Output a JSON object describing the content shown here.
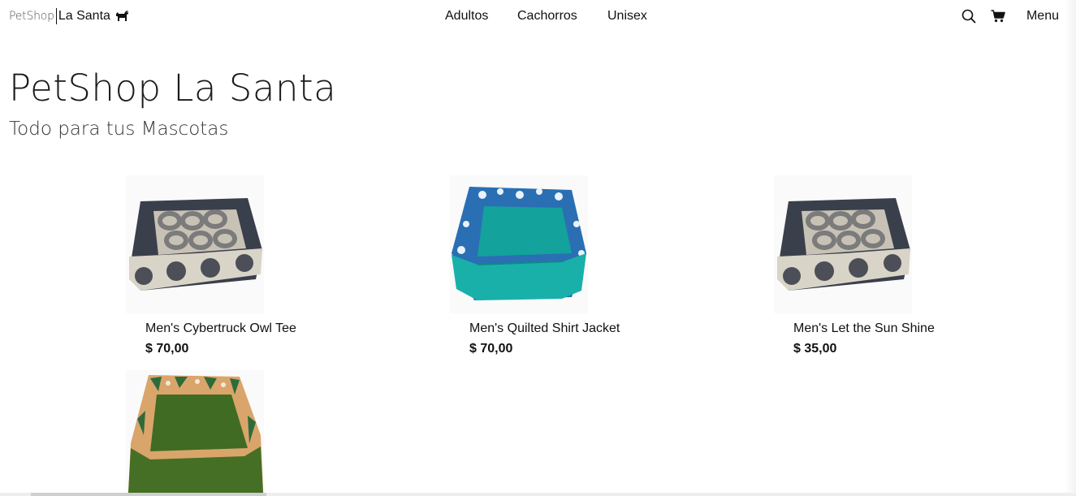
{
  "brand": {
    "part1": "PetShop",
    "part2": "La Santa",
    "icon": "dog-icon"
  },
  "nav": {
    "items": [
      {
        "label": "Adultos"
      },
      {
        "label": "Cachorros"
      },
      {
        "label": "Unisex"
      }
    ]
  },
  "header_actions": {
    "search_icon": "search-icon",
    "cart_icon": "cart-icon",
    "menu_label": "Menu"
  },
  "hero": {
    "title": "PetShop La Santa",
    "subtitle": "Todo para tus Mascotas"
  },
  "products": [
    {
      "name": "Men's Cybertruck Owl Tee",
      "price": "$ 70,00",
      "image": "gray-circle-pattern-pet-bed"
    },
    {
      "name": "Men's Quilted Shirt Jacket",
      "price": "$ 70,00",
      "image": "teal-blue-pattern-pet-bed"
    },
    {
      "name": "Men's Let the Sun Shine",
      "price": "$ 35,00",
      "image": "gray-circle-pattern-pet-bed"
    },
    {
      "name": "",
      "price": "",
      "image": "green-tropical-pattern-pet-bed"
    }
  ],
  "colors": {
    "text": "#111111",
    "background": "#ffffff"
  }
}
